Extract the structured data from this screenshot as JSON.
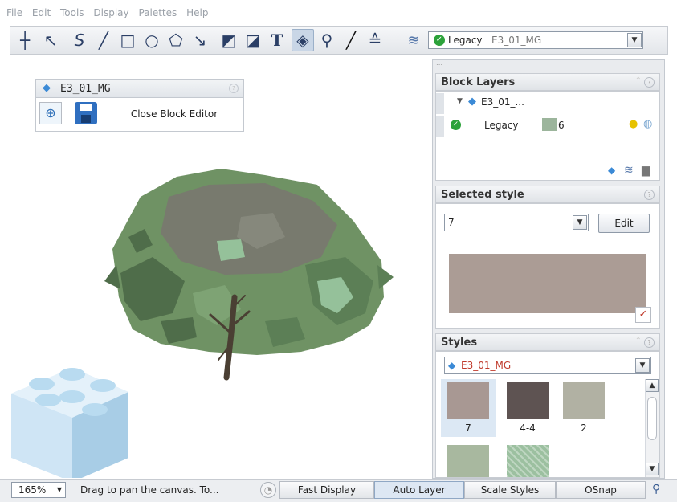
{
  "menu": [
    "File",
    "Edit",
    "Tools",
    "Display",
    "Palettes",
    "Help"
  ],
  "toolbar": {
    "tools": [
      {
        "icon": "crosshair-icon",
        "glyph": "┼"
      },
      {
        "icon": "select-arrow-icon",
        "glyph": "↖"
      },
      {
        "icon": "bezier-curve-icon",
        "glyph": "S"
      },
      {
        "icon": "line-icon",
        "glyph": "╱"
      },
      {
        "icon": "rectangle-icon",
        "glyph": "□"
      },
      {
        "icon": "ellipse-icon",
        "glyph": "○"
      },
      {
        "icon": "polygon-icon",
        "glyph": "⬠"
      },
      {
        "icon": "pen-icon",
        "glyph": "↘"
      },
      {
        "icon": "paint-bucket-icon",
        "glyph": "◩"
      },
      {
        "icon": "style-dropper-icon",
        "glyph": "◪"
      },
      {
        "icon": "text-icon",
        "glyph": "T"
      },
      {
        "icon": "eraser-icon",
        "glyph": "◈"
      },
      {
        "icon": "zoom-icon",
        "glyph": "⚲"
      },
      {
        "icon": "brush-icon",
        "glyph": "╱"
      },
      {
        "icon": "align-icon",
        "glyph": "≙"
      }
    ],
    "layer_icon": "layers-icon",
    "current_layer": "Legacy",
    "current_block": "E3_01_MG"
  },
  "block_editor": {
    "title": "E3_01_MG",
    "close_label": "Close Block Editor"
  },
  "block_layers": {
    "title": "Block Layers",
    "block_name": "E3_01_...",
    "layer_name": "Legacy",
    "layer_style": "6"
  },
  "selected_style": {
    "title": "Selected style",
    "value": "7",
    "edit_label": "Edit",
    "swatch_color": "#ab9c95"
  },
  "styles": {
    "title": "Styles",
    "library": "E3_01_MG",
    "items": [
      {
        "label": "7",
        "color": "#a89893",
        "selected": true
      },
      {
        "label": "4-4",
        "color": "#5e5352",
        "selected": false
      },
      {
        "label": "2",
        "color": "#b1b1a3",
        "selected": false
      },
      {
        "label": "",
        "color": "#a8b89f",
        "selected": false
      },
      {
        "label": "",
        "color": "#9cc0a0",
        "selected": false
      }
    ]
  },
  "status": {
    "zoom": "165%",
    "hint": "Drag to pan the canvas. To...",
    "fast_display": "Fast Display",
    "auto_layer": "Auto Layer",
    "scale_styles": "Scale Styles",
    "osnap": "OSnap"
  }
}
